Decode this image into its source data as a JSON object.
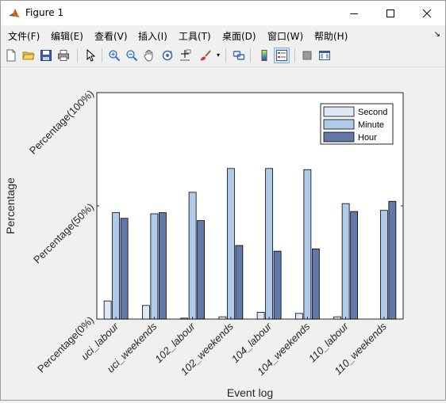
{
  "window": {
    "title": "Figure 1"
  },
  "menu": [
    {
      "label": "文件(F)"
    },
    {
      "label": "编辑(E)"
    },
    {
      "label": "查看(V)"
    },
    {
      "label": "插入(I)"
    },
    {
      "label": "工具(T)"
    },
    {
      "label": "桌面(D)"
    },
    {
      "label": "窗口(W)"
    },
    {
      "label": "帮助(H)"
    }
  ],
  "toolbar": {
    "icons": [
      "new-figure-icon",
      "open-file-icon",
      "save-icon",
      "print-icon",
      "pointer-icon",
      "zoom-in-icon",
      "zoom-out-icon",
      "pan-hand-icon",
      "rotate-3d-icon",
      "data-cursor-icon",
      "brush-icon",
      "link-plot-icon",
      "colorbar-icon",
      "legend-icon",
      "hide-plot-tools-icon",
      "show-plot-tools-icon"
    ]
  },
  "colors": {
    "second": "#dde9f6",
    "minute": "#b0cbea",
    "hour": "#6378a8"
  },
  "chart_data": {
    "type": "bar",
    "xlabel": "Event log",
    "ylabel": "Percentage",
    "ylim": [
      0,
      1
    ],
    "yticks": [
      0,
      0.5,
      1
    ],
    "ytick_labels": [
      "Percentage(0%)",
      "Percentage(50%)",
      "Percentage(100%)"
    ],
    "categories": [
      "uci_labour",
      "uci_weekends",
      "102_labour",
      "102_weekends",
      "104_labour",
      "104_weekends",
      "110_labour",
      "110_weekends"
    ],
    "series": [
      {
        "name": "Second",
        "values": [
          0.08,
          0.06,
          0.004,
          0.01,
          0.03,
          0.025,
          0.01,
          0.0
        ]
      },
      {
        "name": "Minute",
        "values": [
          0.47,
          0.465,
          0.56,
          0.665,
          0.665,
          0.66,
          0.51,
          0.48
        ]
      },
      {
        "name": "Hour",
        "values": [
          0.445,
          0.47,
          0.435,
          0.325,
          0.3,
          0.31,
          0.475,
          0.52
        ]
      }
    ],
    "legend_position": "top-right",
    "grid": false
  }
}
